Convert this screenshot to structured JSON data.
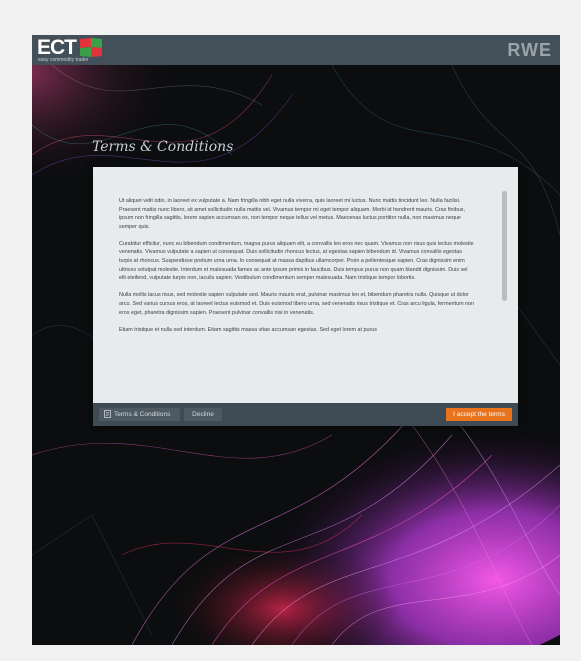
{
  "header": {
    "logo_text": "ECT",
    "logo_tagline": "easy commodity trader",
    "brand": "RWE"
  },
  "page": {
    "title": "Terms & Conditions"
  },
  "terms": {
    "paragraphs": [
      "Ut aliquet velit odio, in laoreet ex vulputate a. Nam fringilla nibh eget nulla viverra, quis laoreet mi luctus. Nunc mattis tincidunt leo. Nulla facilisi. Praesent mattis nunc libero, sit amet sollicitudin nulla mattis vel. Vivamus tempor mi eget tempor aliquam. Morbi id hendrerit mauris. Cras finibus, ipsum non fringilla sagittis, lorem sapien accumsan ex, non tempor neque tellus vel metus. Maecenas luctus porttitor nulla, non maximus neque semper quis.",
      "Curabitur efficitur, nunc eu bibendum condimentum, magna purus aliquam elit, a convallis leo eros nec quam. Vivamus non risus quis lectus molestie venenatis. Vivamus vulputate a sapien ut consequat. Duis sollicitudin rhoncus lectus, at egestas sapien bibendum id. Vivamus convallis egestas turpis at rhoncus. Suspendisse pretium urna urna. In consequat at massa dapibus ullamcorper. Proin a pellentesque sapien. Cras dignissim enim ultrices volutpat molestie. Interdum et malesuada fames ac ante ipsum primis in faucibus. Duis tempus purus non quam blandit dignissim. Duis vel elit eleifend, vulputate turpis non, iaculis sapien. Vestibulum condimentum semper malesuada. Nam tristique tempor lobortis.",
      "Nulla mollis lacus risus, sed molestie sapien vulputate sed. Mauris mauris erat, pulvinar maximus leo et, bibendum pharetra nulla. Quisque ut dolor arcu. Sed varius cursus eros, at laoreet lectus euismod et. Duis euismod libero urna, sed venenatis risus tristique et. Cras arcu ligula, fermentum non eros eget, pharetra dignissim sapien. Praesent pulvinar convallis nisi in venenatis.",
      "Etiam tristique et nulla sed interdum. Etiam sagittis massa vitae accumsan egestas. Sed eget lorem at purus"
    ]
  },
  "footer": {
    "terms_button": "Terms & Conditions",
    "decline_button": "Decline",
    "accept_button": "I accept the terms"
  },
  "icons": {
    "terms": "document-icon",
    "logo_mark": "flag-logo-icon"
  },
  "colors": {
    "topbar": "#43505a",
    "accent": "#e9731c",
    "dialog_bg": "#e9eaec",
    "footer_bg": "#3f4b54"
  }
}
